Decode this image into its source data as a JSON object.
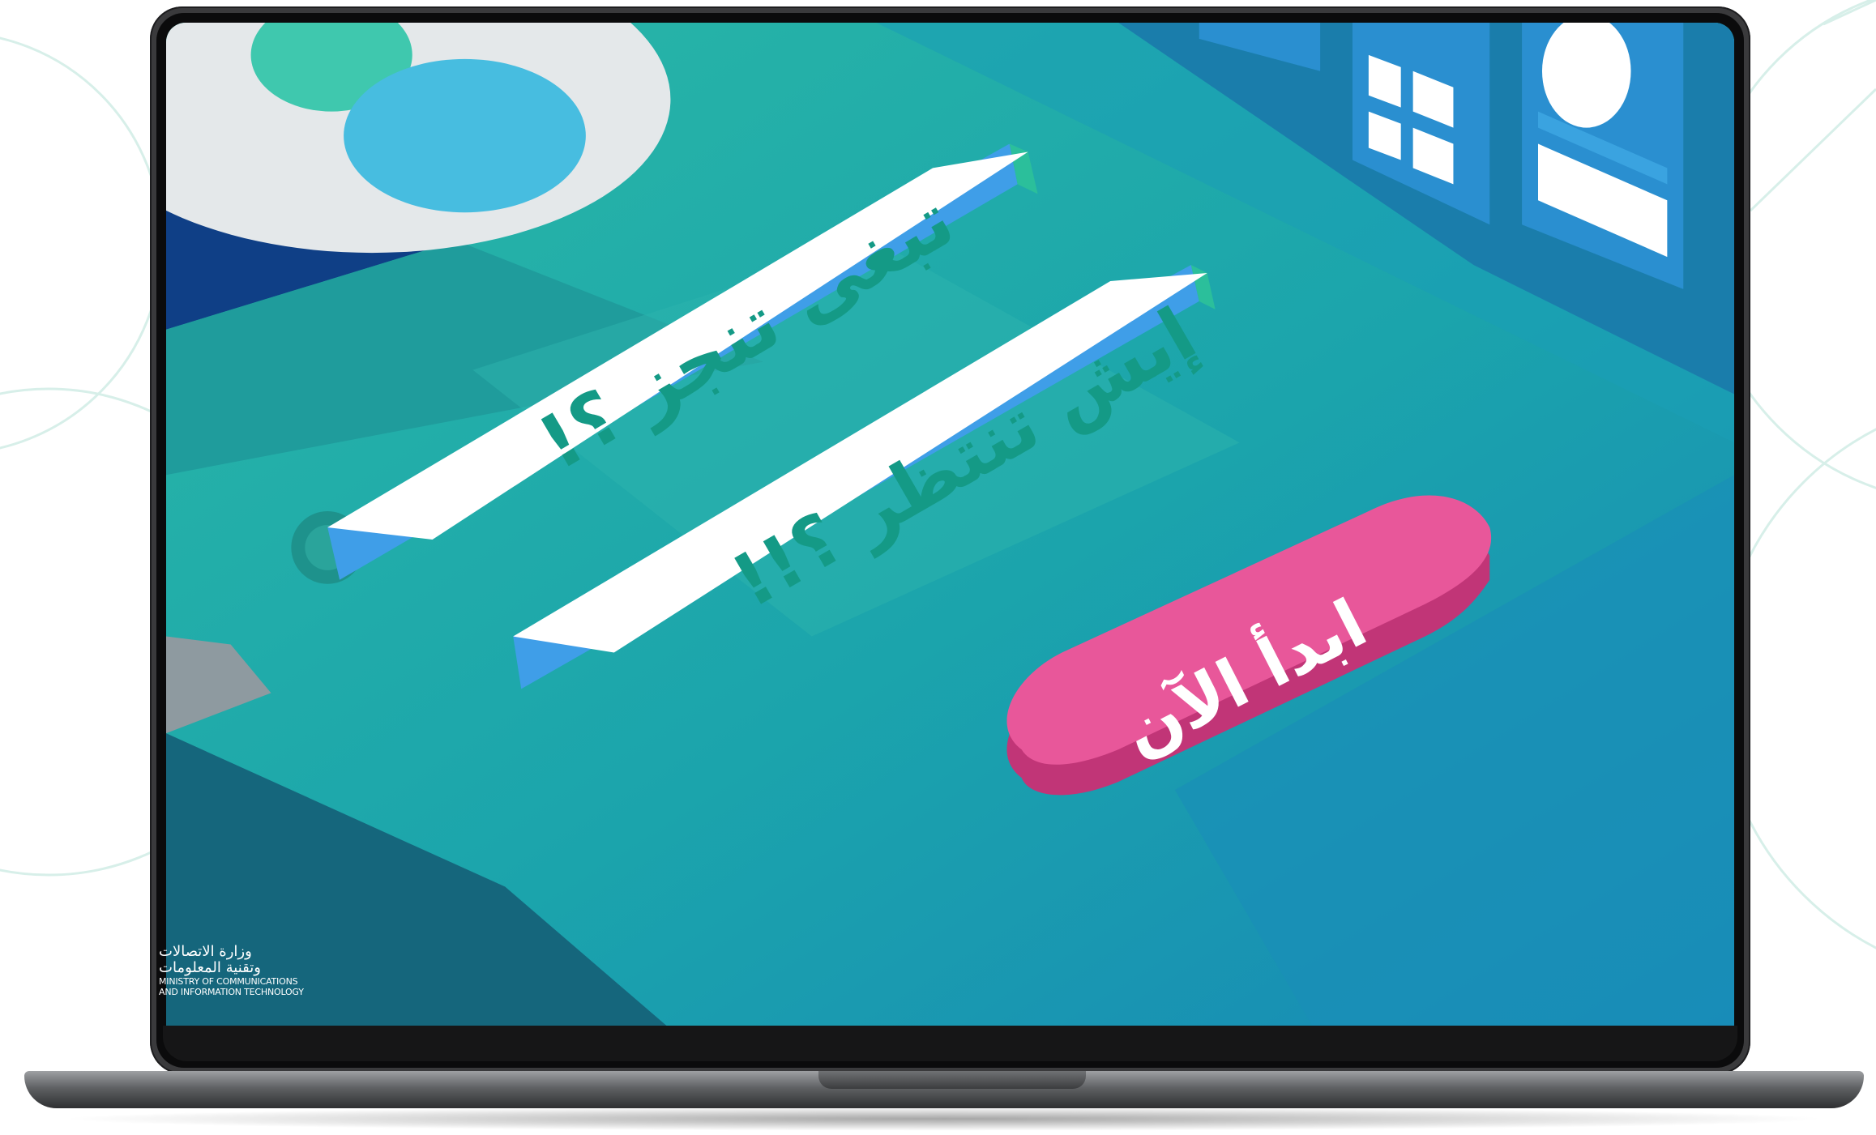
{
  "banner": {
    "headline_1": "تبغى تنجز ؟!",
    "headline_2": "إيش تنتظر ؟!!",
    "cta_label": "ابدأ الآن"
  },
  "logo": {
    "arabic_line_1": "وزارة الاتصالات",
    "arabic_line_2": "وتقنية المعلومات",
    "english_line_1": "MINISTRY OF COMMUNICATIONS",
    "english_line_2": "AND INFORMATION TECHNOLOGY"
  },
  "colors": {
    "screen_teal": "#1aa7a8",
    "slab_white": "#ffffff",
    "slab_side_green": "#2bbf9b",
    "slab_side_blue": "#3f9ee8",
    "headline_text": "#149a86",
    "cta_pink": "#e8579a",
    "cta_pink_side": "#c13577",
    "laptop_body": "#3a3a3c"
  }
}
